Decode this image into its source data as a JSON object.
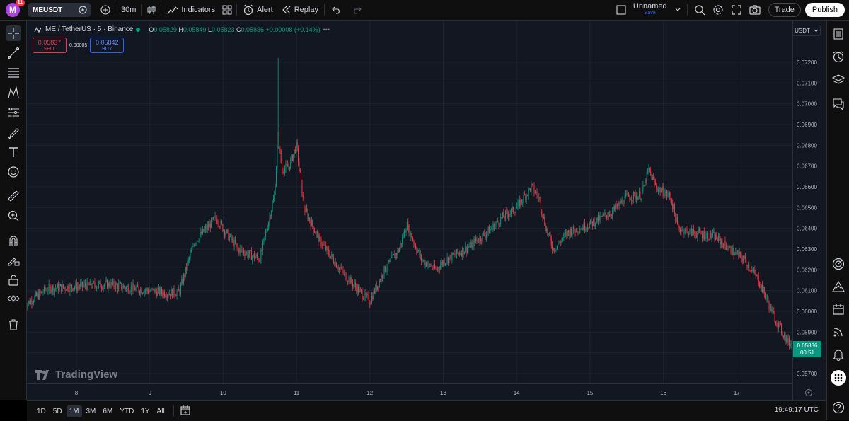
{
  "topbar": {
    "avatar_letter": "M",
    "notification_count": "11",
    "symbol": "MEUSDT",
    "interval": "30m",
    "indicators_label": "Indicators",
    "alert_label": "Alert",
    "replay_label": "Replay",
    "layout_name": "Unnamed",
    "save_label": "Save",
    "trade_label": "Trade",
    "publish_label": "Publish"
  },
  "legend": {
    "title": "ME / TetherUS · 5 · Binance",
    "open_label": "O",
    "open": "0.05829",
    "high_label": "H",
    "high": "0.05849",
    "low_label": "L",
    "low": "0.05823",
    "close_label": "C",
    "close": "0.05836",
    "change": "+0.00008 (+0.14%)"
  },
  "order": {
    "sell_price": "0.05837",
    "sell_label": "SELL",
    "spread": "0.00005",
    "buy_price": "0.05842",
    "buy_label": "BUY"
  },
  "currency": "USDT",
  "last_price": {
    "value": "0.05836",
    "countdown": "00:51"
  },
  "watermark": "TradingView",
  "bottom": {
    "ranges": [
      "1D",
      "5D",
      "1M",
      "3M",
      "6M",
      "YTD",
      "1Y",
      "All"
    ],
    "active_range": "1M",
    "time": "19:49:17 UTC"
  },
  "colors": {
    "up": "#089981",
    "down": "#f23645",
    "background": "#131722",
    "accent": "#2962ff"
  },
  "icons": {
    "left_toolbar": [
      "crosshair-icon",
      "trend-line-icon",
      "fib-icon",
      "pattern-icon",
      "forecast-icon",
      "brush-icon",
      "text-icon",
      "emoji-icon",
      "ruler-icon",
      "zoom-icon",
      "magnet-icon",
      "lock-draw-icon",
      "lock-icon",
      "eye-icon",
      "trash-icon"
    ],
    "right_toolbar": [
      "watchlist-icon",
      "alerts-clock-icon",
      "layers-icon",
      "chat-icon",
      "target-icon",
      "ideas-icon",
      "calendar-icon",
      "streams-icon",
      "notification-icon",
      "apps-icon",
      "help-icon"
    ]
  },
  "chart_data": {
    "type": "line",
    "series_style": "candlestick",
    "ylim": [
      0.0565,
      0.0725
    ],
    "y_ticks": [
      "0.07200",
      "0.07100",
      "0.07000",
      "0.06900",
      "0.06800",
      "0.06700",
      "0.06600",
      "0.06500",
      "0.06400",
      "0.06300",
      "0.06200",
      "0.06100",
      "0.06000",
      "0.05900",
      "0.05800",
      "0.05700"
    ],
    "x_ticks": [
      "8",
      "9",
      "10",
      "11",
      "12",
      "13",
      "14",
      "15",
      "16",
      "17"
    ],
    "x": [
      7.3,
      7.6,
      8.0,
      8.4,
      8.8,
      9.2,
      9.4,
      9.6,
      9.9,
      10.2,
      10.5,
      10.7,
      10.75,
      10.8,
      10.9,
      11.0,
      11.1,
      11.3,
      11.6,
      11.9,
      12.0,
      12.2,
      12.4,
      12.5,
      12.7,
      12.9,
      13.0,
      13.3,
      13.6,
      13.8,
      14.0,
      14.2,
      14.3,
      14.4,
      14.5,
      14.7,
      15.0,
      15.3,
      15.5,
      15.7,
      15.8,
      15.9,
      16.1,
      16.2,
      16.4,
      16.7,
      16.9,
      17.1,
      17.3,
      17.5,
      17.7,
      17.8
    ],
    "values": [
      0.0603,
      0.0611,
      0.0612,
      0.0613,
      0.0611,
      0.0609,
      0.0609,
      0.0633,
      0.0645,
      0.063,
      0.0625,
      0.0656,
      0.0685,
      0.0668,
      0.067,
      0.068,
      0.065,
      0.0635,
      0.062,
      0.0608,
      0.0605,
      0.062,
      0.063,
      0.0642,
      0.0625,
      0.062,
      0.0624,
      0.063,
      0.0638,
      0.0645,
      0.065,
      0.066,
      0.0655,
      0.064,
      0.063,
      0.0638,
      0.0642,
      0.0648,
      0.0655,
      0.0656,
      0.0668,
      0.066,
      0.0655,
      0.064,
      0.0638,
      0.0636,
      0.063,
      0.0625,
      0.0615,
      0.0598,
      0.0585,
      0.0584
    ]
  }
}
